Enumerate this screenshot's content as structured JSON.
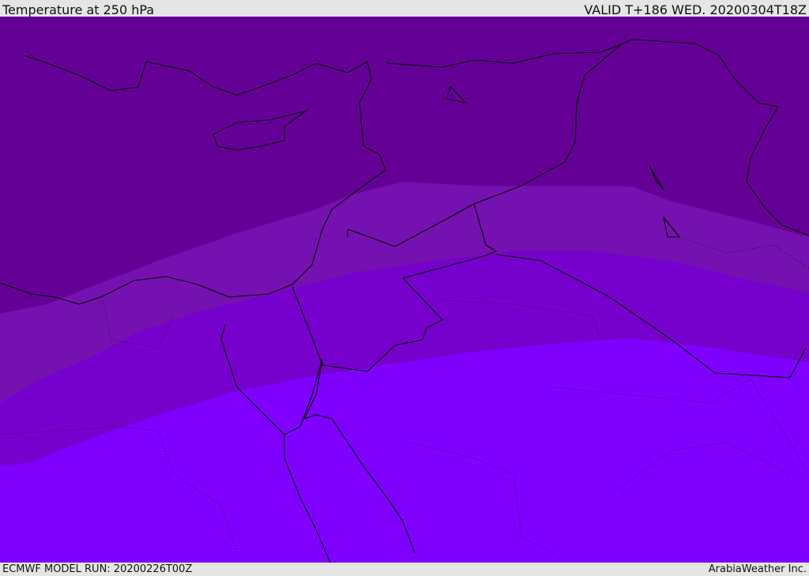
{
  "header": {
    "title": "Temperature at 250 hPa",
    "valid": "VALID T+186 WED. 20200304T18Z"
  },
  "footer": {
    "model_run": "ECMWF MODEL RUN: 20200226T00Z",
    "credit": "ArabiaWeather Inc."
  },
  "colors": {
    "band_coldest": "#650096",
    "band_2": "#7511b0",
    "band_3": "#7600cc",
    "band_warmest": "#7f00ff",
    "coastline": "#000000"
  }
}
